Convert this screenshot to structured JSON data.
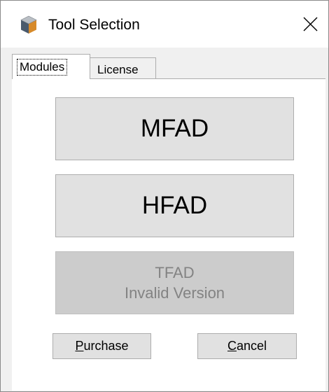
{
  "window": {
    "title": "Tool Selection",
    "app_icon": "cube-icon",
    "close_glyph": "✕"
  },
  "tabs": [
    {
      "label": "Modules",
      "selected": true
    },
    {
      "label": "License",
      "selected": false
    }
  ],
  "modules": {
    "mfad_label": "MFAD",
    "hfad_label": "HFAD",
    "tfad_label": "TFAD",
    "tfad_status": "Invalid Version"
  },
  "actions": {
    "purchase_mnemonic": "P",
    "purchase_rest": "urchase",
    "cancel_mnemonic": "C",
    "cancel_rest": "ancel"
  },
  "colors": {
    "button_face": "#e1e1e1",
    "disabled_face": "#cccccc",
    "disabled_text": "#838383",
    "border": "#adadad"
  }
}
